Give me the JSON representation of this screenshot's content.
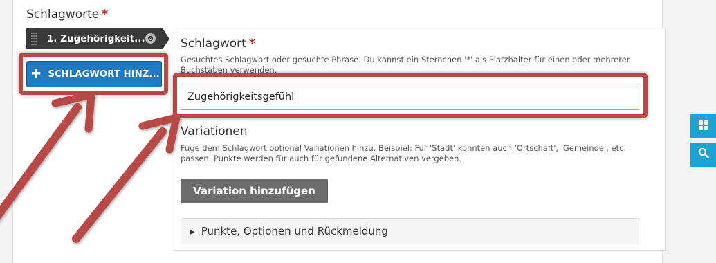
{
  "section": {
    "title": "Schlagworte",
    "required_mark": "*"
  },
  "tab": {
    "label": "1. Zugehörigkeit...",
    "close_glyph": "⊗"
  },
  "add_button": {
    "icon": "plus-icon",
    "label": "SCHLAGWORT HINZ..."
  },
  "keyword": {
    "title": "Schlagwort",
    "required_mark": "*",
    "help": "Gesuchtes Schlagwort oder gesuchte Phrase. Du kannst ein Sternchen '*' als Platzhalter für einen oder mehrerer Buchstaben verwenden.",
    "value": "Zugehörigkeitsgefühl"
  },
  "variations": {
    "title": "Variationen",
    "help": "Füge dem Schlagwort optional Variationen hinzu. Beispiel: Für 'Stadt' könnten auch 'Ortschaft', 'Gemeinde', etc. passen. Punkte werden für auch für gefundene Alternativen vergeben.",
    "button_label": "Variation hinzufügen"
  },
  "options_panel": {
    "label": "Punkte, Optionen und Rückmeldung",
    "icon": "caret-right-icon"
  },
  "side_icons": [
    "grid-icon",
    "search-icon"
  ],
  "colors": {
    "accent_blue": "#1f7bc1",
    "annotation_red": "#b74846",
    "side_teal": "#1ea2d1",
    "required_red": "#c22222"
  }
}
